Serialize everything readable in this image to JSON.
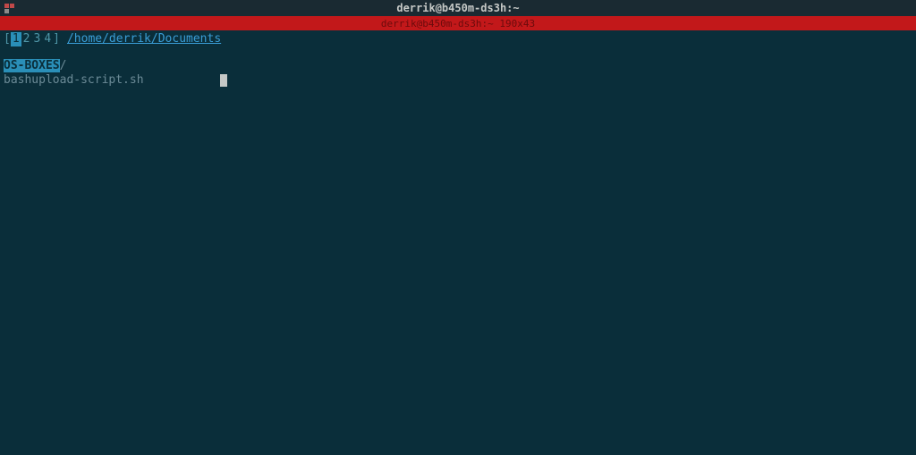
{
  "titlebar": {
    "title": "derrik@b450m-ds3h:~"
  },
  "statusbar": {
    "text": "derrik@b450m-ds3h:~ 190x43"
  },
  "workspaces": {
    "open_bracket": "[",
    "close_bracket": "]",
    "items": [
      "1",
      "2",
      "3",
      "4"
    ],
    "active_index": 0
  },
  "path": "/home/derrik/Documents",
  "listing": {
    "dir_name": "OS-BOXES",
    "dir_suffix": "/",
    "file": "bashupload-script.sh"
  }
}
